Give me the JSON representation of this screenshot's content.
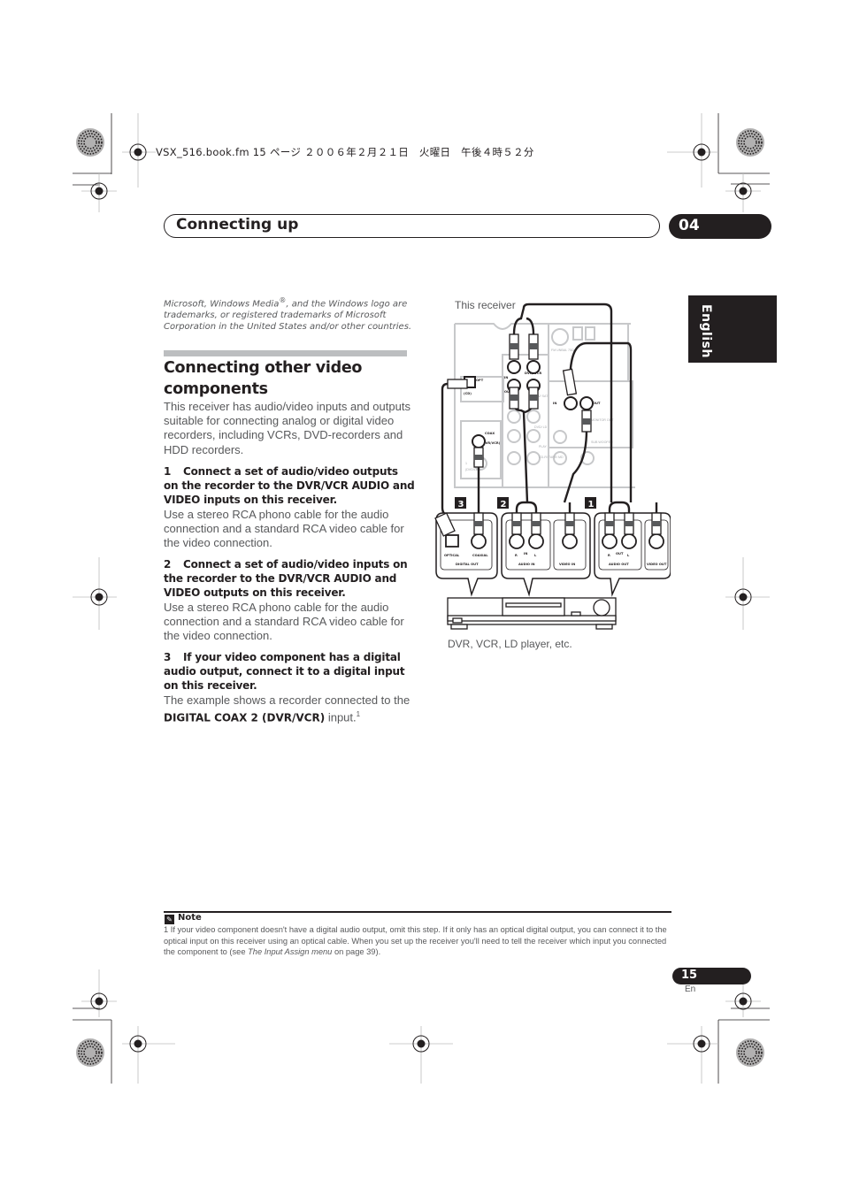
{
  "file_info": "VSX_516.book.fm  15 ページ  ２００６年２月２１日　火曜日　午後４時５２分",
  "chapter": {
    "title": "Connecting up",
    "number": "04"
  },
  "language_tab": "English",
  "trademark_note": {
    "pre": "Microsoft, Windows Media",
    "reg": "®",
    "post": ", and the Windows logo are trademarks, or registered trademarks of Microsoft Corporation in the United States and/or other countries."
  },
  "section": {
    "title": "Connecting other video components",
    "intro": "This receiver has audio/video inputs and outputs suitable for connecting analog or digital video recorders, including VCRs, DVD-recorders and HDD recorders.",
    "steps": [
      {
        "number": "1",
        "heading": "Connect a set of audio/video outputs on the recorder to the DVR/VCR AUDIO and VIDEO inputs on this receiver.",
        "body": "Use a stereo RCA phono cable for the audio connection and a standard RCA video cable for the video connection."
      },
      {
        "number": "2",
        "heading": "Connect a set of audio/video inputs on the recorder to the DVR/VCR AUDIO and VIDEO outputs on this receiver.",
        "body": "Use a stereo RCA phono cable for the audio connection and a standard RCA video cable for the video connection."
      },
      {
        "number": "3",
        "heading": "If your video component has a digital audio output, connect it to a digital input on this receiver.",
        "body_pre": "The example shows a recorder connected to the ",
        "body_bold": "DIGITAL COAX 2 (DVR/VCR)",
        "body_post": " input.",
        "footnote_ref": "1"
      }
    ]
  },
  "diagram": {
    "receiver_label": "This receiver",
    "device_label": "DVR, VCR, LD player, etc.",
    "callouts": [
      "3",
      "2",
      "1"
    ],
    "panels": {
      "digital_out": {
        "title": "DIGITAL OUT",
        "jacks": [
          "OPTICAL",
          "COAXIAL"
        ]
      },
      "audio_in": {
        "title": "AUDIO IN",
        "jacks": [
          "R",
          "L"
        ],
        "badge": "IN"
      },
      "video_in": {
        "title": "VIDEO IN"
      },
      "audio_out": {
        "title": "AUDIO OUT",
        "jacks": [
          "R",
          "L"
        ],
        "badge": "OUT"
      },
      "video_out": {
        "title": "VIDEO OUT"
      }
    },
    "receiver_panel_labels": {
      "opt": "OPT",
      "opt_num": "1",
      "cd": "(CD)",
      "coax": "COAX",
      "coax2": "2",
      "dvr_vcr_coax": "(DVR/VCR)",
      "coax1": "1",
      "dvd_ld_coax": "(DVD/LD)",
      "in": "IN",
      "out": "OUT",
      "dvr_vcr": "DVR/ VCR",
      "tv_sat": "TV/ SAT",
      "dvd_ld": "DVD/ LD",
      "play": "PLAY",
      "cd_r_tape": "CD-R/ TAPE/ MD",
      "monitor_out": "MONITOR OUT",
      "subwoofer": "SUB WOOFER",
      "fm": "FM UNBAL 75Ω"
    }
  },
  "note": {
    "heading": "Note",
    "text_pre": "1 If your video component doesn't have a digital audio output, omit this step. If it only has an optical digital output, you can connect it to the optical input on this receiver using an optical cable. When you set up the receiver you'll need to tell the receiver which input you connected the component to (see ",
    "text_italic": "The Input Assign menu",
    "text_post": " on page 39)."
  },
  "page": {
    "number": "15",
    "lang": "En"
  }
}
